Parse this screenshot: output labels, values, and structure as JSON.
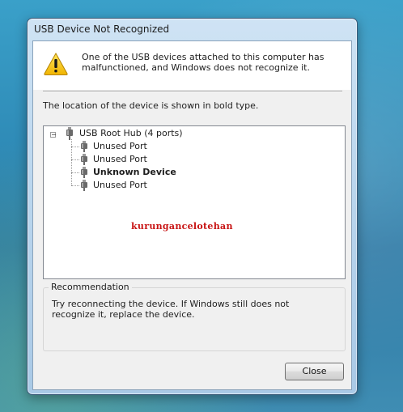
{
  "window": {
    "title": "USB Device Not Recognized"
  },
  "header": {
    "icon": "warning-icon",
    "message": "One of the USB devices attached to this computer has malfunctioned, and Windows does not recognize it."
  },
  "location_note": "The location of the device is shown in bold type.",
  "tree": {
    "root": {
      "label": "USB Root Hub (4 ports)",
      "icon": "usb-plug-icon",
      "expander": "−"
    },
    "children": [
      {
        "label": "Unused Port",
        "bold": false
      },
      {
        "label": "Unused Port",
        "bold": false
      },
      {
        "label": "Unknown Device",
        "bold": true
      },
      {
        "label": "Unused Port",
        "bold": false
      }
    ]
  },
  "watermark": "kurungancelotehan",
  "recommendation": {
    "title": "Recommendation",
    "body": "Try reconnecting the device. If Windows still does not recognize it, replace the device."
  },
  "buttons": {
    "close": "Close"
  },
  "colors": {
    "desktop": "#2f8bb7",
    "watermark": "#c81414",
    "warning": "#f4c400"
  }
}
